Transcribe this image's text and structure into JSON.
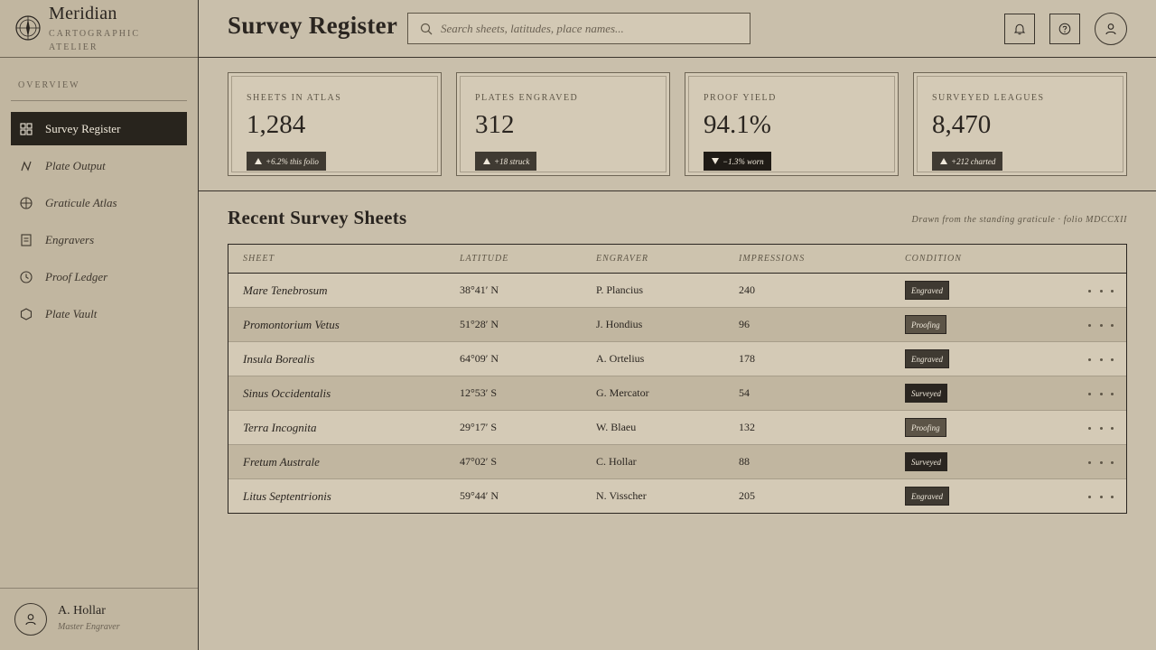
{
  "brand": {
    "title": "Meridian",
    "subtitle": "CARTOGRAPHIC ATELIER",
    "logo_icon": "compass-rose-icon"
  },
  "sidebar": {
    "section_label": "OVERVIEW",
    "items": [
      {
        "label": "Survey Register",
        "icon": "grid-icon",
        "active": true
      },
      {
        "label": "Plate Output",
        "icon": "zigzag-icon",
        "active": false
      },
      {
        "label": "Graticule Atlas",
        "icon": "globe-icon",
        "active": false
      },
      {
        "label": "Engravers",
        "icon": "document-icon",
        "active": false
      },
      {
        "label": "Proof Ledger",
        "icon": "clock-icon",
        "active": false
      },
      {
        "label": "Plate Vault",
        "icon": "hexagon-icon",
        "active": false
      }
    ]
  },
  "profile": {
    "name": "A. Hollar",
    "role": "Master Engraver"
  },
  "header": {
    "title": "Survey Register",
    "search_placeholder": "Search sheets, latitudes, place names..."
  },
  "stats": [
    {
      "label": "SHEETS IN ATLAS",
      "value": "1,284",
      "delta": "+6.2% this folio",
      "direction": "up"
    },
    {
      "label": "PLATES ENGRAVED",
      "value": "312",
      "delta": "+18 struck",
      "direction": "up"
    },
    {
      "label": "PROOF YIELD",
      "value": "94.1%",
      "delta": "−1.3% worn",
      "direction": "down"
    },
    {
      "label": "SURVEYED LEAGUES",
      "value": "8,470",
      "delta": "+212 charted",
      "direction": "up"
    }
  ],
  "table": {
    "title": "Recent Survey Sheets",
    "note": "Drawn from the standing graticule · folio MDCCXII",
    "columns": [
      "SHEET",
      "LATITUDE",
      "ENGRAVER",
      "IMPRESSIONS",
      "CONDITION"
    ],
    "rows": [
      {
        "sheet": "Mare Tenebrosum",
        "latitude": "38°41′ N",
        "engraver": "P. Plancius",
        "impressions": "240",
        "condition": "Engraved"
      },
      {
        "sheet": "Promontorium Vetus",
        "latitude": "51°28′ N",
        "engraver": "J. Hondius",
        "impressions": "96",
        "condition": "Proofing"
      },
      {
        "sheet": "Insula Borealis",
        "latitude": "64°09′ N",
        "engraver": "A. Ortelius",
        "impressions": "178",
        "condition": "Engraved"
      },
      {
        "sheet": "Sinus Occidentalis",
        "latitude": "12°53′ S",
        "engraver": "G. Mercator",
        "impressions": "54",
        "condition": "Surveyed"
      },
      {
        "sheet": "Terra Incognita",
        "latitude": "29°17′ S",
        "engraver": "W. Blaeu",
        "impressions": "132",
        "condition": "Proofing"
      },
      {
        "sheet": "Fretum Australe",
        "latitude": "47°02′ S",
        "engraver": "C. Hollar",
        "impressions": "88",
        "condition": "Surveyed"
      },
      {
        "sheet": "Litus Septentrionis",
        "latitude": "59°44′ N",
        "engraver": "N. Visscher",
        "impressions": "205",
        "condition": "Engraved"
      }
    ]
  },
  "colors": {
    "background": "#c9bfab",
    "sidebar": "#c1b6a0",
    "ink": "#2a2520",
    "active_nav": "#28241d",
    "badge": "#3f3a32"
  }
}
